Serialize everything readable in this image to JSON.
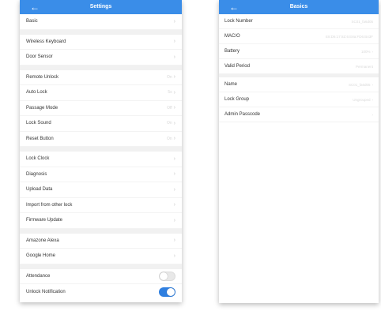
{
  "settings": {
    "back_label": "←",
    "title": "Settings",
    "groups": [
      [
        {
          "label": "Basic",
          "value": "",
          "chevron": "›"
        }
      ],
      [
        {
          "label": "Wireless Keyboard",
          "value": "",
          "chevron": "›"
        },
        {
          "label": "Door Sensor",
          "value": "",
          "chevron": "›"
        }
      ],
      [
        {
          "label": "Remote Unlock",
          "value": "On",
          "chevron": "›"
        },
        {
          "label": "Auto Lock",
          "value": "5s",
          "chevron": "›"
        },
        {
          "label": "Passage Mode",
          "value": "Off",
          "chevron": "›"
        },
        {
          "label": "Lock Sound",
          "value": "On",
          "chevron": "›"
        },
        {
          "label": "Reset Button",
          "value": "On",
          "chevron": "›"
        }
      ],
      [
        {
          "label": "Lock Clock",
          "value": "",
          "chevron": "›"
        },
        {
          "label": "Diagnosis",
          "value": "",
          "chevron": "›"
        },
        {
          "label": "Upload Data",
          "value": "",
          "chevron": "›"
        },
        {
          "label": "Import from other lock",
          "value": "",
          "chevron": "›"
        },
        {
          "label": "Firmware Update",
          "value": "",
          "chevron": "›"
        }
      ],
      [
        {
          "label": "Amazone Alexa",
          "value": "",
          "chevron": "›"
        },
        {
          "label": "Google Home",
          "value": "",
          "chevron": "›"
        }
      ]
    ],
    "toggles": [
      {
        "label": "Attendance",
        "state": "off"
      },
      {
        "label": "Unlock Notification",
        "state": "on"
      }
    ]
  },
  "basics": {
    "back_label": "←",
    "title": "Basics",
    "group1": [
      {
        "label": "Lock Number",
        "value": "SC01_fa6d05",
        "chevron": ""
      },
      {
        "label": "MAC/O",
        "value": "E8:D6:17:8Z:6:E8a:FD6:B43F",
        "chevron": ""
      },
      {
        "label": "Battery",
        "value": "100%",
        "chevron": "›"
      },
      {
        "label": "Valid Period",
        "value": "Permanent",
        "chevron": ""
      }
    ],
    "group2": [
      {
        "label": "Name",
        "value": "SC01_fa6d05",
        "chevron": "›"
      },
      {
        "label": "Lock Group",
        "value": "Ungrouped",
        "chevron": "›"
      },
      {
        "label": "Admin Passcode",
        "value": "",
        "chevron": "›"
      }
    ]
  },
  "colors": {
    "header": "#3a8de8",
    "toggle_on": "#2f7fe0",
    "separator": "#f1f1f1"
  },
  "icons": {
    "back": "arrow-left-icon",
    "chevron": "chevron-right-icon"
  }
}
